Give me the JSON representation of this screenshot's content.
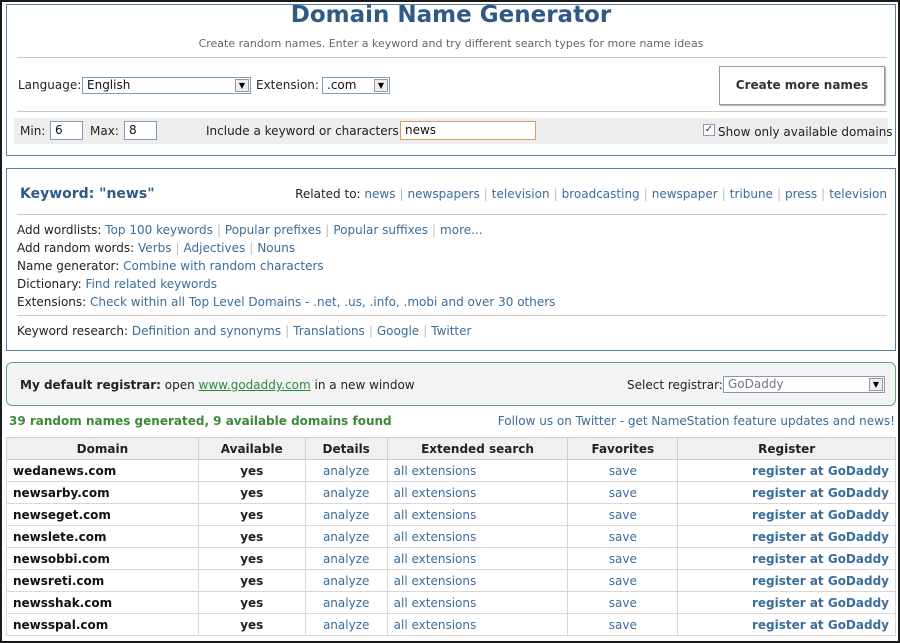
{
  "header": {
    "title": "Domain Name Generator",
    "subtitle": "Create random names. Enter a keyword and try different search types for more name ideas"
  },
  "form": {
    "language_label": "Language:",
    "language_value": "English",
    "extension_label": "Extension:",
    "extension_value": ".com",
    "create_button": "Create more names",
    "min_label": "Min:",
    "min_value": "6",
    "max_label": "Max:",
    "max_value": "8",
    "keyword_label": "Include a keyword or characters:",
    "keyword_value": "news",
    "available_label": "Show only available domains",
    "available_checked": true
  },
  "keyword_panel": {
    "title": "Keyword: \"news\"",
    "related_label": "Related to:",
    "related": [
      "news",
      "newspapers",
      "television",
      "broadcasting",
      "newspaper",
      "tribune",
      "press",
      "television"
    ],
    "wordlists_label": "Add wordlists:",
    "wordlists": [
      "Top 100 keywords",
      "Popular prefixes",
      "Popular suffixes",
      "more..."
    ],
    "random_label": "Add random words:",
    "random_words": [
      "Verbs",
      "Adjectives",
      "Nouns"
    ],
    "namegen_label": "Name generator:",
    "namegen_link": "Combine with random characters",
    "dictionary_label": "Dictionary:",
    "dictionary_link": "Find related keywords",
    "extensions_label": "Extensions:",
    "extensions_link": "Check within all Top Level Domains - .net, .us, .info, .mobi and over 30 others",
    "research_label": "Keyword research:",
    "research_links": [
      "Definition and synonyms",
      "Translations",
      "Google",
      "Twitter"
    ]
  },
  "registrar": {
    "label": "My default registrar:",
    "open_text": "open",
    "link": "www.godaddy.com",
    "suffix": "in a new window",
    "select_label": "Select registrar:",
    "select_value": "GoDaddy"
  },
  "summary": "39 random names generated, 9 available domains found",
  "follow": "Follow us on Twitter - get NameStation feature updates and news!",
  "table": {
    "headers": [
      "Domain",
      "Available",
      "Details",
      "Extended search",
      "Favorites",
      "Register"
    ],
    "rows": [
      {
        "domain": "wedanews.com",
        "available": "yes",
        "details": "analyze",
        "extended": "all extensions",
        "favorites": "save",
        "register": "register at GoDaddy"
      },
      {
        "domain": "newsarby.com",
        "available": "yes",
        "details": "analyze",
        "extended": "all extensions",
        "favorites": "save",
        "register": "register at GoDaddy"
      },
      {
        "domain": "newseget.com",
        "available": "yes",
        "details": "analyze",
        "extended": "all extensions",
        "favorites": "save",
        "register": "register at GoDaddy"
      },
      {
        "domain": "newslete.com",
        "available": "yes",
        "details": "analyze",
        "extended": "all extensions",
        "favorites": "save",
        "register": "register at GoDaddy"
      },
      {
        "domain": "newsobbi.com",
        "available": "yes",
        "details": "analyze",
        "extended": "all extensions",
        "favorites": "save",
        "register": "register at GoDaddy"
      },
      {
        "domain": "newsreti.com",
        "available": "yes",
        "details": "analyze",
        "extended": "all extensions",
        "favorites": "save",
        "register": "register at GoDaddy"
      },
      {
        "domain": "newsshak.com",
        "available": "yes",
        "details": "analyze",
        "extended": "all extensions",
        "favorites": "save",
        "register": "register at GoDaddy"
      },
      {
        "domain": "newsspal.com",
        "available": "yes",
        "details": "analyze",
        "extended": "all extensions",
        "favorites": "save",
        "register": "register at GoDaddy"
      }
    ]
  }
}
